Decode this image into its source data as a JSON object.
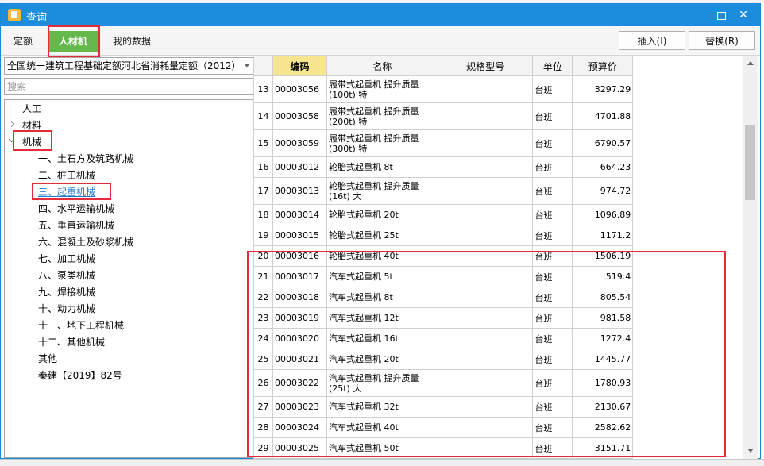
{
  "window": {
    "title": "查询"
  },
  "tabs": [
    {
      "label": "定额"
    },
    {
      "label": "人材机"
    },
    {
      "label": "我的数据"
    }
  ],
  "actions": {
    "insert_label": "插入(I)",
    "replace_label": "替换(R)"
  },
  "library": {
    "selected": "全国统一建筑工程基础定额河北省消耗量定额（2012）"
  },
  "search": {
    "placeholder": "搜索"
  },
  "tree": {
    "labor": "人工",
    "material": "材料",
    "machinery": "机械",
    "children": [
      "一、土石方及筑路机械",
      "二、桩工机械",
      "三、起重机械",
      "四、水平运输机械",
      "五、垂直运输机械",
      "六、混凝土及砂浆机械",
      "七、加工机械",
      "八、泵类机械",
      "九、焊接机械",
      "十、动力机械",
      "十一、地下工程机械",
      "十二、其他机械"
    ],
    "other": "其他",
    "qinjian": "秦建【2019】82号"
  },
  "grid": {
    "headers": {
      "code": "编码",
      "name": "名称",
      "spec": "规格型号",
      "unit": "单位",
      "price": "预算价"
    },
    "rows": [
      {
        "idx": "13",
        "code": "00003056",
        "name": "履带式起重机 提升质量(100t) 特",
        "unit": "台班",
        "price": "3297.29"
      },
      {
        "idx": "14",
        "code": "00003058",
        "name": "履带式起重机 提升质量(200t) 特",
        "unit": "台班",
        "price": "4701.88"
      },
      {
        "idx": "15",
        "code": "00003059",
        "name": "履带式起重机 提升质量(300t) 特",
        "unit": "台班",
        "price": "6790.57"
      },
      {
        "idx": "16",
        "code": "00003012",
        "name": "轮胎式起重机 8t",
        "unit": "台班",
        "price": "664.23"
      },
      {
        "idx": "17",
        "code": "00003013",
        "name": "轮胎式起重机 提升质量(16t) 大",
        "unit": "台班",
        "price": "974.72"
      },
      {
        "idx": "18",
        "code": "00003014",
        "name": "轮胎式起重机 20t",
        "unit": "台班",
        "price": "1096.89"
      },
      {
        "idx": "19",
        "code": "00003015",
        "name": "轮胎式起重机 25t",
        "unit": "台班",
        "price": "1171.2"
      },
      {
        "idx": "20",
        "code": "00003016",
        "name": "轮胎式起重机 40t",
        "unit": "台班",
        "price": "1506.19"
      },
      {
        "idx": "21",
        "code": "00003017",
        "name": "汽车式起重机 5t",
        "unit": "台班",
        "price": "519.4"
      },
      {
        "idx": "22",
        "code": "00003018",
        "name": "汽车式起重机 8t",
        "unit": "台班",
        "price": "805.54"
      },
      {
        "idx": "23",
        "code": "00003019",
        "name": "汽车式起重机 12t",
        "unit": "台班",
        "price": "981.58"
      },
      {
        "idx": "24",
        "code": "00003020",
        "name": "汽车式起重机 16t",
        "unit": "台班",
        "price": "1272.4"
      },
      {
        "idx": "25",
        "code": "00003021",
        "name": "汽车式起重机 20t",
        "unit": "台班",
        "price": "1445.77"
      },
      {
        "idx": "26",
        "code": "00003022",
        "name": "汽车式起重机 提升质量(25t) 大",
        "unit": "台班",
        "price": "1780.93"
      },
      {
        "idx": "27",
        "code": "00003023",
        "name": "汽车式起重机 32t",
        "unit": "台班",
        "price": "2130.67"
      },
      {
        "idx": "28",
        "code": "00003024",
        "name": "汽车式起重机 40t",
        "unit": "台班",
        "price": "2582.62"
      },
      {
        "idx": "29",
        "code": "00003025",
        "name": "汽车式起重机 50t",
        "unit": "台班",
        "price": "3151.71"
      }
    ]
  },
  "colors": {
    "titlebar": "#1c8ddc",
    "active_tab": "#64b84c",
    "highlight_header": "#f8e58f",
    "annotation": "#e52b3a",
    "selected_node": "#1f7ad1"
  }
}
